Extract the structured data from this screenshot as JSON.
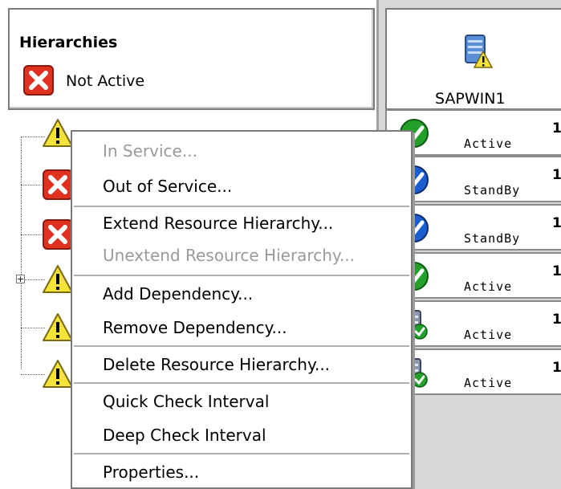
{
  "hierarchies_panel": {
    "title": "Hierarchies",
    "status_label": "Not Active",
    "status_icon": "x-icon",
    "tree_nodes": [
      {
        "icon": "warning-icon"
      },
      {
        "icon": "x-icon"
      },
      {
        "icon": "x-icon"
      },
      {
        "icon": "warning-icon"
      },
      {
        "icon": "warning-icon"
      },
      {
        "icon": "warning-icon"
      }
    ]
  },
  "server": {
    "name": "SAPWIN1",
    "icon": "server-warning-icon",
    "states": [
      {
        "label": "Active",
        "icon": "check-green-icon",
        "priority": "1"
      },
      {
        "label": "StandBy",
        "icon": "check-blue-icon",
        "priority": "1"
      },
      {
        "label": "StandBy",
        "icon": "check-blue-icon",
        "priority": "1"
      },
      {
        "label": "Active",
        "icon": "check-green-icon",
        "priority": "1"
      },
      {
        "label": "Active",
        "icon": "server-check-icon",
        "priority": "1"
      },
      {
        "label": "Active",
        "icon": "server-check-icon",
        "priority": "1"
      }
    ]
  },
  "context_menu": {
    "items": [
      {
        "label": "In Service...",
        "enabled": false
      },
      {
        "label": "Out of Service...",
        "enabled": true
      },
      {
        "label": "Extend Resource Hierarchy...",
        "enabled": true
      },
      {
        "label": "Unextend Resource Hierarchy...",
        "enabled": false
      },
      {
        "label": "Add Dependency...",
        "enabled": true
      },
      {
        "label": "Remove Dependency...",
        "enabled": true
      },
      {
        "label": "Delete Resource Hierarchy...",
        "enabled": true
      },
      {
        "label": "Quick Check Interval",
        "enabled": true
      },
      {
        "label": "Deep Check Interval",
        "enabled": true
      },
      {
        "label": "Properties...",
        "enabled": true
      }
    ]
  },
  "colors": {
    "error_red": "#e03020",
    "warning_yellow": "#f5e33a",
    "active_green": "#22a02a",
    "standby_blue": "#1a5fcf"
  }
}
